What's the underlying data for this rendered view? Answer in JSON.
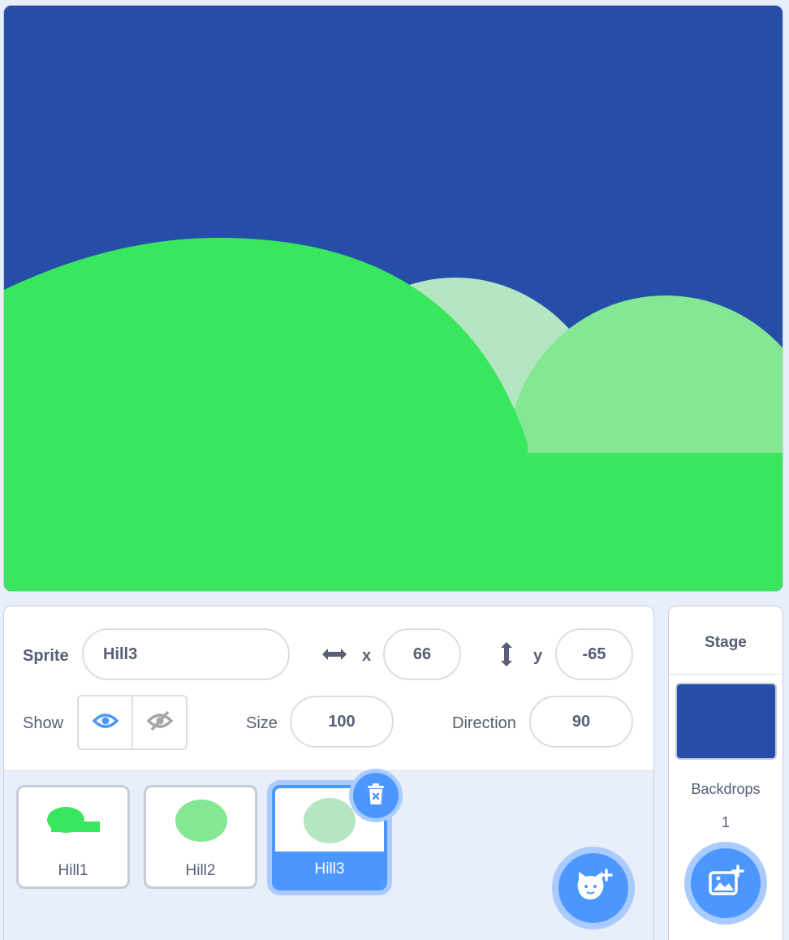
{
  "stage": {
    "background_color": "#264ea8",
    "hill_colors": {
      "hill1": "#39e75f",
      "hill2": "#83e794",
      "hill3": "#b5e6c2"
    }
  },
  "sprite_info": {
    "sprite_label": "Sprite",
    "sprite_name": "Hill3",
    "x_label": "x",
    "x_value": "66",
    "y_label": "y",
    "y_value": "-65",
    "show_label": "Show",
    "size_label": "Size",
    "size_value": "100",
    "direction_label": "Direction",
    "direction_value": "90"
  },
  "sprites": [
    {
      "name": "Hill1",
      "selected": false
    },
    {
      "name": "Hill2",
      "selected": false
    },
    {
      "name": "Hill3",
      "selected": true
    }
  ],
  "stage_panel": {
    "title": "Stage",
    "backdrops_label": "Backdrops",
    "backdrops_count": "1"
  },
  "colors": {
    "accent": "#4c97ff",
    "accent_light": "#a9cbff",
    "text": "#575e75"
  },
  "icons": [
    "show-eye-icon",
    "hide-eye-icon",
    "x-arrow-icon",
    "y-arrow-icon",
    "trash-icon",
    "choose-sprite-cat-icon",
    "choose-backdrop-icon"
  ]
}
